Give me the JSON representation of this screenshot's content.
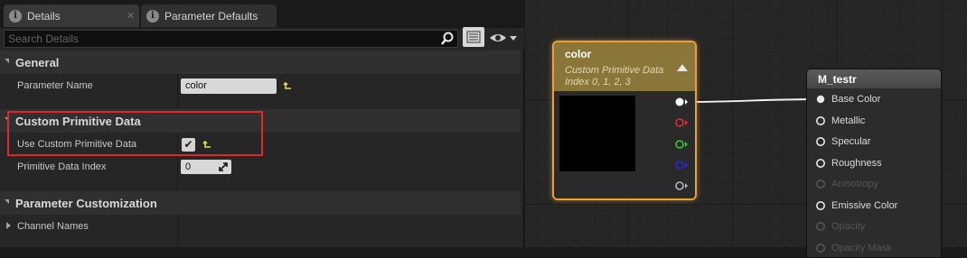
{
  "tabs": [
    {
      "label": "Details",
      "icon": "info-icon"
    },
    {
      "label": "Parameter Defaults",
      "icon": "info-icon"
    }
  ],
  "search": {
    "placeholder": "Search Details"
  },
  "categories": {
    "general": "General",
    "custom_primitive": "Custom Primitive Data",
    "parameter_customization": "Parameter Customization"
  },
  "properties": {
    "parameter_name": {
      "label": "Parameter Name",
      "value": "color"
    },
    "use_custom_primitive": {
      "label": "Use Custom Primitive Data",
      "checked": true,
      "check_glyph": "✔"
    },
    "primitive_data_index": {
      "label": "Primitive Data Index",
      "value": "0"
    },
    "channel_names": {
      "label": "Channel Names"
    }
  },
  "color_node": {
    "title": "color",
    "subtitle_line1": "Custom Primitive Data",
    "subtitle_line2": "Index 0, 1, 2, 3",
    "outputs": [
      "white",
      "red",
      "green",
      "blue",
      "alpha"
    ],
    "pin_colors": {
      "white": "#ffffff",
      "red": "#e03030",
      "green": "#36c836",
      "blue": "#2828e0",
      "alpha": "#b8b8b8"
    }
  },
  "material_node": {
    "title": "M_testr",
    "inputs": [
      {
        "label": "Base Color",
        "enabled": true,
        "connected": true
      },
      {
        "label": "Metallic",
        "enabled": true
      },
      {
        "label": "Specular",
        "enabled": true
      },
      {
        "label": "Roughness",
        "enabled": true
      },
      {
        "label": "Anisotropy",
        "enabled": false
      },
      {
        "label": "Emissive Color",
        "enabled": true
      },
      {
        "label": "Opacity",
        "enabled": false
      },
      {
        "label": "Opacity Mask",
        "enabled": false
      }
    ]
  },
  "colors": {
    "accent_orange": "#e8a233",
    "highlight_red": "#e0282c",
    "reset_yellow": "#e8e040"
  }
}
